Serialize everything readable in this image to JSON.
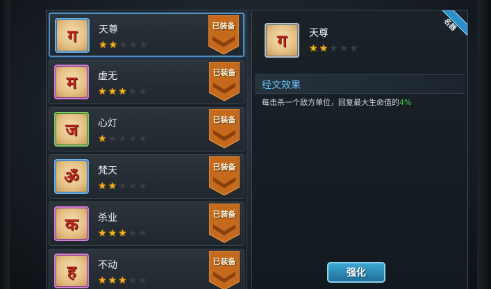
{
  "list": {
    "items": [
      {
        "name": "天尊",
        "glyph": "ग",
        "stars": 2,
        "max_stars": 5,
        "frame": "blue",
        "equipped": "已装备",
        "selected": true
      },
      {
        "name": "虚无",
        "glyph": "म",
        "stars": 3,
        "max_stars": 5,
        "frame": "purple",
        "equipped": "已装备",
        "selected": false
      },
      {
        "name": "心灯",
        "glyph": "ज",
        "stars": 1,
        "max_stars": 5,
        "frame": "green",
        "equipped": "已装备",
        "selected": false
      },
      {
        "name": "梵天",
        "glyph": "ॐ",
        "stars": 2,
        "max_stars": 5,
        "frame": "blue",
        "equipped": "已装备",
        "selected": false
      },
      {
        "name": "杀业",
        "glyph": "क",
        "stars": 3,
        "max_stars": 5,
        "frame": "purple",
        "equipped": "已装备",
        "selected": false
      },
      {
        "name": "不动",
        "glyph": "ह",
        "stars": 3,
        "max_stars": 5,
        "frame": "purple",
        "equipped": "已装备",
        "selected": false
      }
    ]
  },
  "detail": {
    "corner_tag": "名器",
    "name": "天尊",
    "glyph": "ग",
    "stars": 2,
    "max_stars": 5,
    "section_title": "经文效果",
    "desc_prefix": "每击杀一个敌方单位，回复最大生命值的",
    "desc_value": "4%",
    "enhance_label": "强化"
  },
  "colors": {
    "star_on": "#f3b11f",
    "star_off": "#3a3f44",
    "highlight": "#42d04a",
    "section_title": "#6cc6ff",
    "badge": "#c56a1c"
  },
  "icons": {
    "badge": "equipped-banner-icon",
    "star": "star-icon",
    "scripture": "scripture-rune-icon"
  }
}
